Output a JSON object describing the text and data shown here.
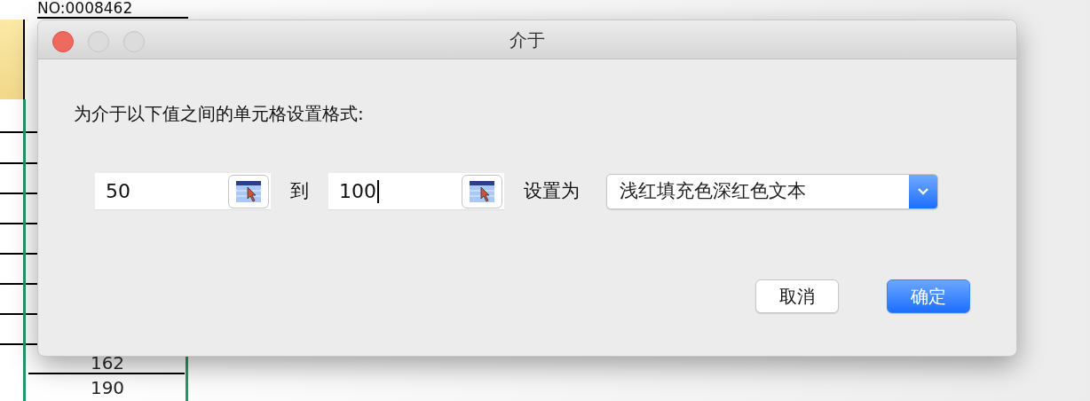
{
  "sheet": {
    "doc_number": "NO:0008462",
    "cells": [
      "162",
      "190"
    ]
  },
  "dialog": {
    "title": "介于",
    "prompt": "为介于以下值之间的单元格设置格式:",
    "range_fields": [
      {
        "value": "50",
        "focused": false
      },
      {
        "value": "100",
        "focused": true
      }
    ],
    "to_label": "到",
    "format_label": "设置为",
    "format_select": "浅红填充色深红色文本",
    "buttons": [
      {
        "label": "取消",
        "kind": "cancel"
      },
      {
        "label": "确定",
        "kind": "default"
      }
    ]
  }
}
